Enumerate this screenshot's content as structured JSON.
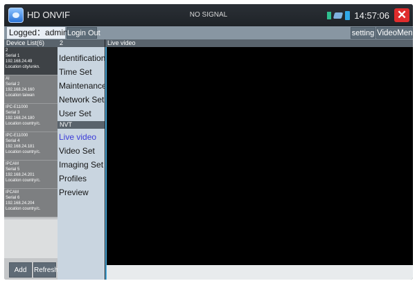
{
  "titlebar": {
    "app_title": "HD ONVIF",
    "signal": "NO SIGNAL",
    "clock": "14:57:06",
    "icons": [
      "app-logo-icon",
      "signal-strength-icon",
      "usb-icon",
      "battery-icon",
      "close-icon"
    ]
  },
  "loginbar": {
    "logged": "Logged：admin",
    "login_out": "Login Out",
    "setting": "setting",
    "video_menu": "VideoMenu"
  },
  "device_list": {
    "header": "Device List(6)",
    "devices": [
      {
        "name": "2",
        "serial": "Serial 1",
        "ip": "192.168.24.49",
        "location": "Location city/unkn.",
        "selected": true
      },
      {
        "name": "AI",
        "serial": "Serial 2",
        "ip": "192.168.24.160",
        "location": "Location taiwan",
        "selected": false
      },
      {
        "name": "IPC-E11000",
        "serial": "Serial 3",
        "ip": "192.168.24.180",
        "location": "Location country/c.",
        "selected": false
      },
      {
        "name": "IPC-E11000",
        "serial": "Serial 4",
        "ip": "192.168.24.181",
        "location": "Location country/c.",
        "selected": false
      },
      {
        "name": "IPCAM",
        "serial": "Serial 5",
        "ip": "192.168.24.201",
        "location": "Location country/c.",
        "selected": false
      },
      {
        "name": "IPCAM",
        "serial": "Serial 6",
        "ip": "192.168.24.204",
        "location": "Location country/c.",
        "selected": false
      }
    ],
    "add": "Add",
    "refresh": "Refresh"
  },
  "menu": {
    "header": "2",
    "items": [
      "Identification",
      "Time Set",
      "Maintenance",
      "Network Set",
      "User Set"
    ],
    "section": "NVT",
    "nvt_items": [
      "Live video",
      "Video Set",
      "Imaging Set",
      "Profiles",
      "Preview"
    ],
    "active_item": "Live video",
    "active_color": "#3b3bd8"
  },
  "video": {
    "header": "Live video"
  }
}
